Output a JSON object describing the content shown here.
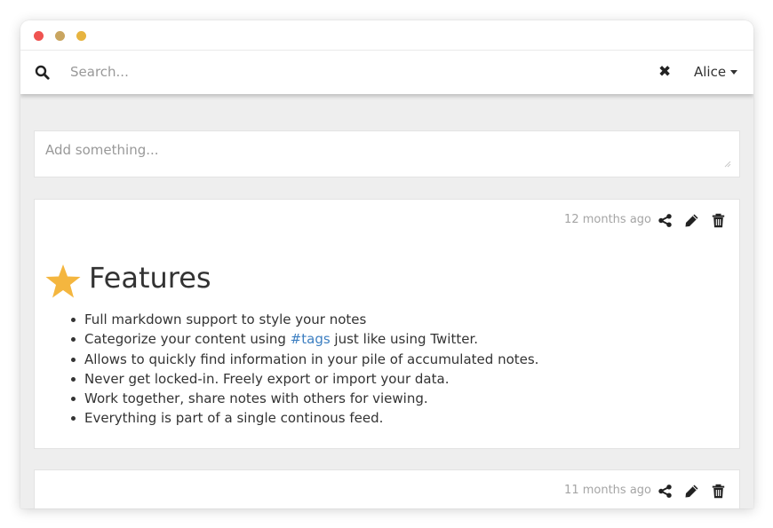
{
  "window": {
    "traffic_lights": [
      {
        "name": "close",
        "color": "#ef5350"
      },
      {
        "name": "minimize",
        "color": "#c9a560"
      },
      {
        "name": "maximize",
        "color": "#e7b440"
      }
    ]
  },
  "header": {
    "search_placeholder": "Search...",
    "search_value": "",
    "search_icon": "search-icon",
    "clear_icon": "close-icon",
    "clear_glyph": "✖",
    "user_name": "Alice"
  },
  "composer": {
    "placeholder": "Add something..."
  },
  "notes": [
    {
      "time": "12 months ago",
      "actions": [
        "share-icon",
        "edit-icon",
        "delete-icon"
      ],
      "title_icon": "star-icon",
      "title": "Features",
      "items": [
        {
          "text": "Full markdown support to style your notes"
        },
        {
          "before": "Categorize your content using ",
          "link": "#tags",
          "after": " just like using Twitter."
        },
        {
          "text": "Allows to quickly find information in your pile of accumulated notes."
        },
        {
          "text": "Never get locked-in. Freely export or import your data."
        },
        {
          "text": "Work together, share notes with others for viewing."
        },
        {
          "text": "Everything is part of a single continous feed."
        }
      ]
    },
    {
      "time": "11 months ago",
      "actions": [
        "share-icon",
        "edit-icon",
        "delete-icon"
      ]
    }
  ],
  "colors": {
    "background": "#eeeeee",
    "card": "#ffffff",
    "link": "#3d7fc1",
    "star": "#f4b63f",
    "muted_text": "#a5a5a5"
  }
}
